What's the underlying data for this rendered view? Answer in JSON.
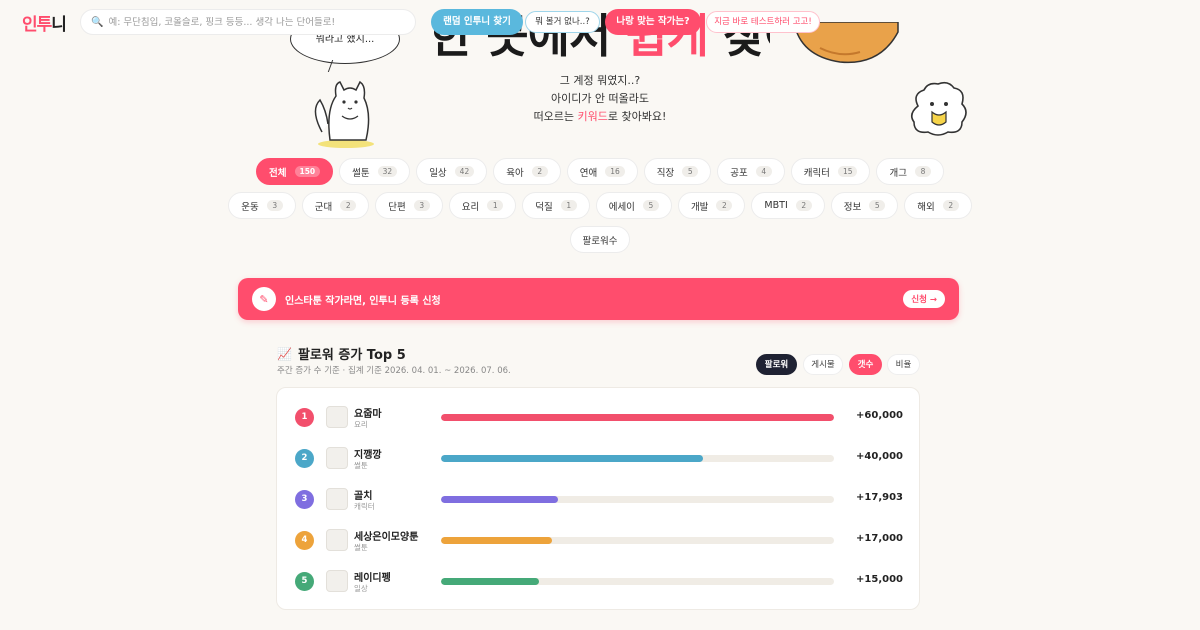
{
  "nav": {
    "logo_main": "인투",
    "logo_tail": "니",
    "search_placeholder": "예: 무단침입, 코올슬로, 핑크 등등... 생각 나는 단어들로!",
    "random_button": "랜덤 인투니 찾기",
    "random_bubble": "뭐 볼거 없나..?",
    "match_button": "나랑 맞는 작가는?",
    "match_bubble": "지금 바로 테스트하러 고고!"
  },
  "hero": {
    "title_start": "한 ",
    "title_mid": "곳에서",
    "title_accent": " 쉽게 ",
    "title_end": "찾아줘",
    "speech": "뭐라고 했지...",
    "sub_line1": "그 계정 뭐였지..?",
    "sub_line2": "아이디가 안 떠올라도",
    "sub_line3_pre": "떠오르는 ",
    "sub_line3_kw": "키워드",
    "sub_line3_post": "로 찾아봐요!"
  },
  "categories": {
    "row1": [
      {
        "label": "전체",
        "count": "150",
        "active": true
      },
      {
        "label": "썰툰",
        "count": "32"
      },
      {
        "label": "일상",
        "count": "42"
      },
      {
        "label": "육아",
        "count": "2"
      },
      {
        "label": "연애",
        "count": "16"
      },
      {
        "label": "직장",
        "count": "5"
      },
      {
        "label": "공포",
        "count": "4"
      },
      {
        "label": "캐릭터",
        "count": "15"
      },
      {
        "label": "개그",
        "count": "8"
      }
    ],
    "row2": [
      {
        "label": "운동",
        "count": "3"
      },
      {
        "label": "군대",
        "count": "2"
      },
      {
        "label": "단편",
        "count": "3"
      },
      {
        "label": "요리",
        "count": "1"
      },
      {
        "label": "덕질",
        "count": "1"
      },
      {
        "label": "에세이",
        "count": "5"
      },
      {
        "label": "개발",
        "count": "2"
      },
      {
        "label": "MBTI",
        "count": "2"
      },
      {
        "label": "정보",
        "count": "5"
      },
      {
        "label": "해외",
        "count": "2"
      }
    ],
    "row3": [
      {
        "label": "팔로워수"
      }
    ]
  },
  "banner": {
    "text": "인스타툰 작가라면, 인투니 등록 신청",
    "button": "신청 →"
  },
  "top5": {
    "title": "팔로워 증가 Top 5",
    "subtitle": "주간 증가 수 기준 · 집계 기준 2026. 04. 01. ~ 2026. 07. 06.",
    "toggles": {
      "follower": "팔로워",
      "posts": "게시물",
      "count": "갯수",
      "ratio": "비율"
    },
    "rows": [
      {
        "rank": "1",
        "name": "요줍마",
        "category": "요리",
        "value": "+60,000",
        "fraction": 1.0,
        "color": "#f24f6c"
      },
      {
        "rank": "2",
        "name": "지깽깡",
        "category": "썰툰",
        "value": "+40,000",
        "fraction": 0.667,
        "color": "#4ba7c8"
      },
      {
        "rank": "3",
        "name": "골치",
        "category": "캐릭터",
        "value": "+17,903",
        "fraction": 0.298,
        "color": "#7f6ee0"
      },
      {
        "rank": "4",
        "name": "세상은이모양툰",
        "category": "썰툰",
        "value": "+17,000",
        "fraction": 0.283,
        "color": "#eda33b"
      },
      {
        "rank": "5",
        "name": "레이디펭",
        "category": "일상",
        "value": "+15,000",
        "fraction": 0.25,
        "color": "#45a978"
      }
    ]
  }
}
